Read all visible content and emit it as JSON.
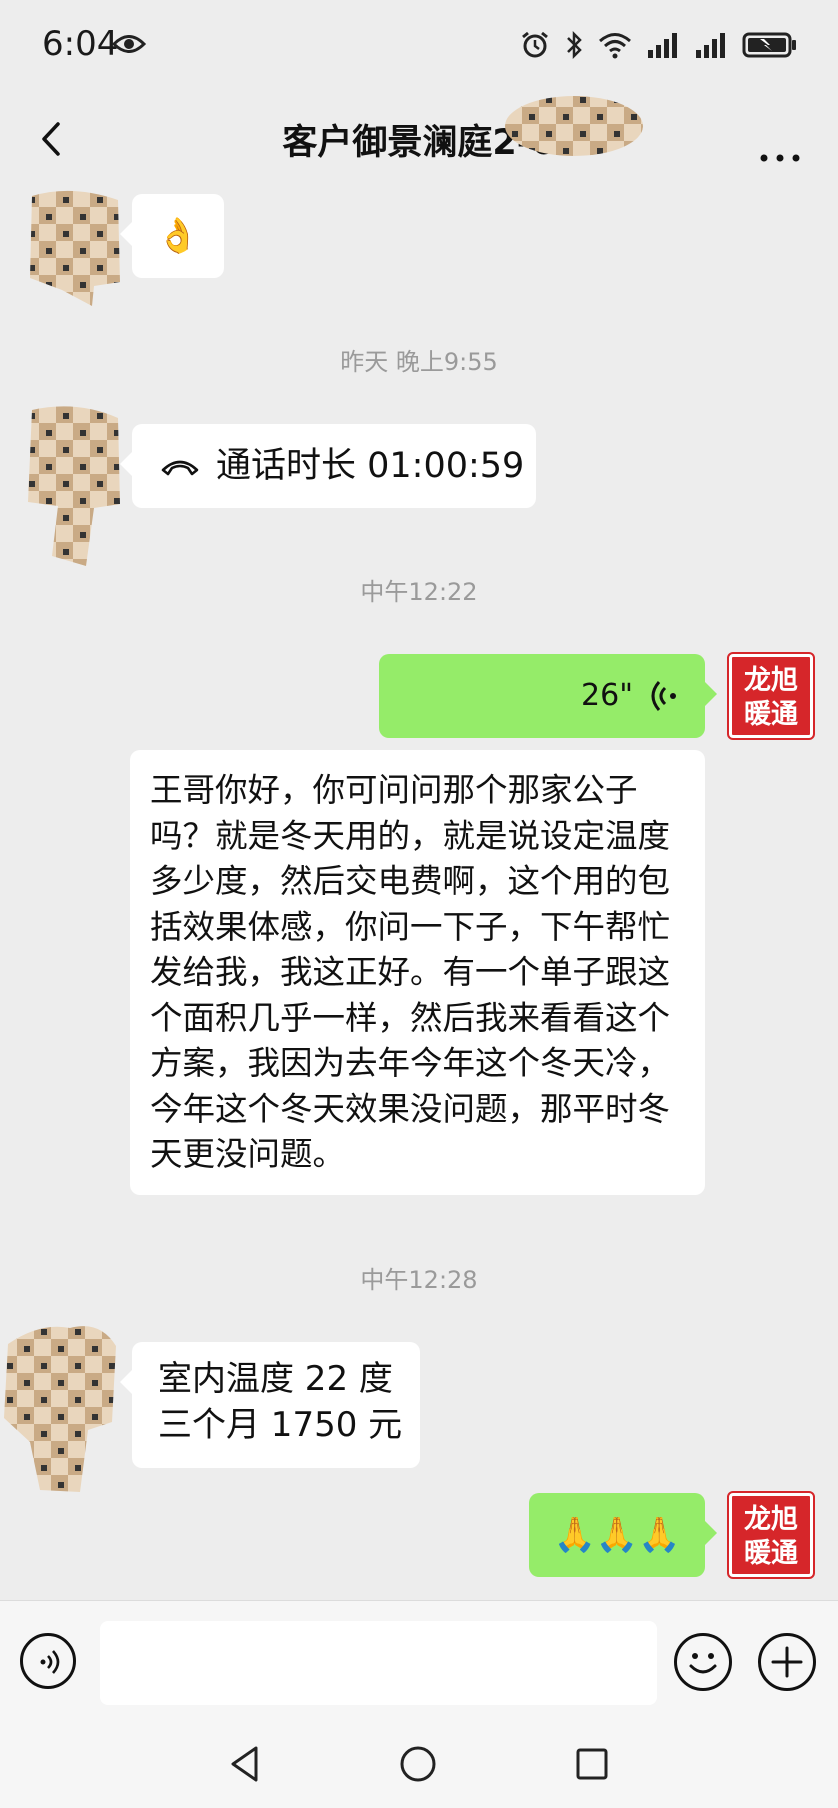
{
  "status_bar": {
    "time": "6:04"
  },
  "header": {
    "title": "客户御景澜庭2-6"
  },
  "messages": [
    {
      "sender": "contact",
      "type": "emoji",
      "content": "👌"
    },
    {
      "type": "timestamp",
      "content": "昨天 晚上9:55"
    },
    {
      "sender": "contact",
      "type": "call",
      "content": "通话时长 01:00:59"
    },
    {
      "type": "timestamp",
      "content": "中午12:22"
    },
    {
      "sender": "me",
      "type": "voice",
      "content": "26\""
    },
    {
      "sender": "me",
      "type": "transcript",
      "content": "王哥你好，你可问问那个那家公子吗？就是冬天用的，就是说设定温度多少度，然后交电费啊，这个用的包括效果体感，你问一下子，下午帮忙发给我，我这正好。有一个单子跟这个面积几乎一样，然后我来看看这个方案，我因为去年今年这个冬天冷，今年这个冬天效果没问题，那平时冬天更没问题。"
    },
    {
      "type": "timestamp",
      "content": "中午12:28"
    },
    {
      "sender": "contact",
      "type": "text",
      "lines": [
        "室内温度 22 度",
        "三个月 1750 元"
      ]
    },
    {
      "sender": "me",
      "type": "emoji",
      "content": "🙏🙏🙏"
    }
  ],
  "my_avatar": {
    "line1": "龙旭",
    "line2": "暖通"
  },
  "input_bar": {
    "placeholder": ""
  },
  "colors": {
    "background": "#ededed",
    "bubble_green": "#95ec69",
    "bubble_white": "#ffffff",
    "logo_red": "#d6262a"
  }
}
